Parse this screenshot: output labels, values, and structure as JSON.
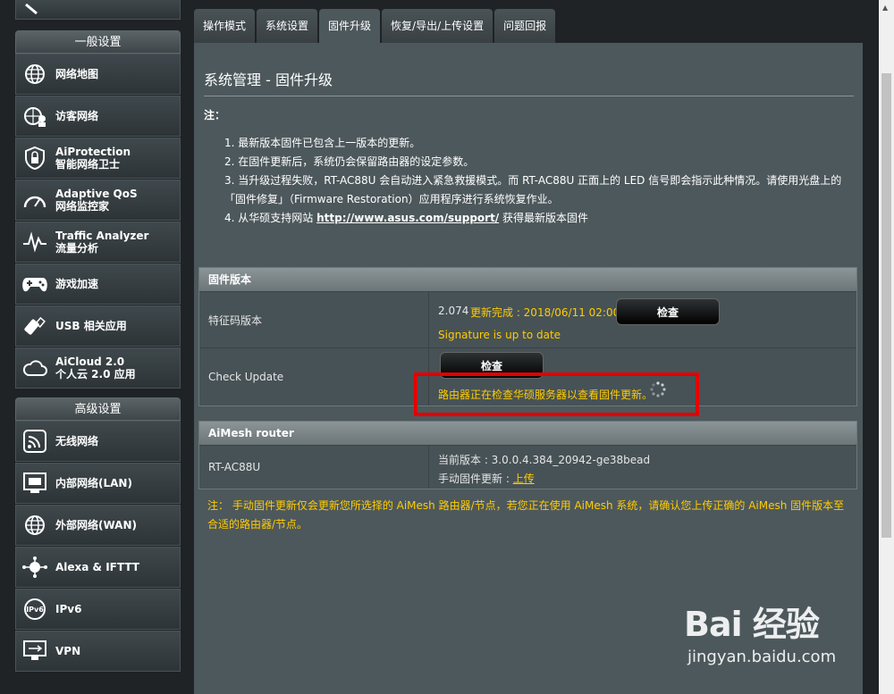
{
  "sidebar": {
    "general_heading": "一般设置",
    "general_items": [
      {
        "label": "网络地图",
        "icon": "globe-network-icon"
      },
      {
        "label": "访客网络",
        "icon": "guest-network-icon"
      },
      {
        "label": "AiProtection",
        "label2": "智能网络卫士",
        "icon": "shield-lock-icon"
      },
      {
        "label": "Adaptive QoS",
        "label2": "网络监控家",
        "icon": "speedometer-icon"
      },
      {
        "label": "Traffic Analyzer",
        "label2": "流量分析",
        "icon": "pulse-icon"
      },
      {
        "label": "游戏加速",
        "icon": "gamepad-icon"
      },
      {
        "label": "USB 相关应用",
        "icon": "usb-icon"
      },
      {
        "label": "AiCloud 2.0",
        "label2": "个人云 2.0 应用",
        "icon": "cloud-icon"
      }
    ],
    "advanced_heading": "高级设置",
    "advanced_items": [
      {
        "label": "无线网络",
        "icon": "wireless-icon"
      },
      {
        "label": "内部网络(LAN)",
        "icon": "lan-icon"
      },
      {
        "label": "外部网络(WAN)",
        "icon": "wan-globe-icon"
      },
      {
        "label": "Alexa & IFTTT",
        "icon": "alexa-icon"
      },
      {
        "label": "IPv6",
        "icon": "ipv6-icon"
      },
      {
        "label": "VPN",
        "icon": "vpn-icon"
      }
    ]
  },
  "tabs": [
    {
      "label": "操作模式",
      "active": false
    },
    {
      "label": "系统设置",
      "active": false
    },
    {
      "label": "固件升级",
      "active": true
    },
    {
      "label": "恢复/导出/上传设置",
      "active": false
    },
    {
      "label": "问题回报",
      "active": false
    }
  ],
  "page": {
    "title": "系统管理 - 固件升级",
    "note_label": "注：",
    "notes": {
      "n1": "1. 最新版本固件已包含上一版本的更新。",
      "n2": "2. 在固件更新后，系统仍会保留路由器的设定参数。",
      "n3": "3. 当升级过程失败，RT-AC88U 会自动进入紧急救援模式。而 RT-AC88U 正面上的 LED 信号即会指示此种情况。请使用光盘上的「固件修复」（Firmware Restoration）应用程序进行系统恢复作业。",
      "n4_prefix": "4. 从华硕支持网站 ",
      "n4_link": "http://www.asus.com/support/",
      "n4_suffix": " 获得最新版本固件"
    }
  },
  "firmware": {
    "heading": "固件版本",
    "signature_label": "特征码版本",
    "signature_version": "2.074",
    "update_done": "更新完成 : 2018/06/11 02:00",
    "check_label": "检查",
    "signature_status": "Signature is up to date",
    "check_update_label": "Check Update",
    "check_update_button": "检查",
    "checking_msg": "路由器正在检查华硕服务器以查看固件更新。"
  },
  "aimesh": {
    "heading": "AiMesh router",
    "model": "RT-AC88U",
    "current_version": "当前版本 : 3.0.0.4.384_20942-ge38bead",
    "manual_update_prefix": "手动固件更新 : ",
    "manual_update_link": "上传"
  },
  "footnote": "注： 手动固件更新仅会更新您所选择的 AiMesh 路由器/节点，若您正在使用 AiMesh 系统，请确认您上传正确的 AiMesh 固件版本至合适的路由器/节点。",
  "watermark": {
    "logo": "Bai 经验",
    "url": "jingyan.baidu.com"
  }
}
